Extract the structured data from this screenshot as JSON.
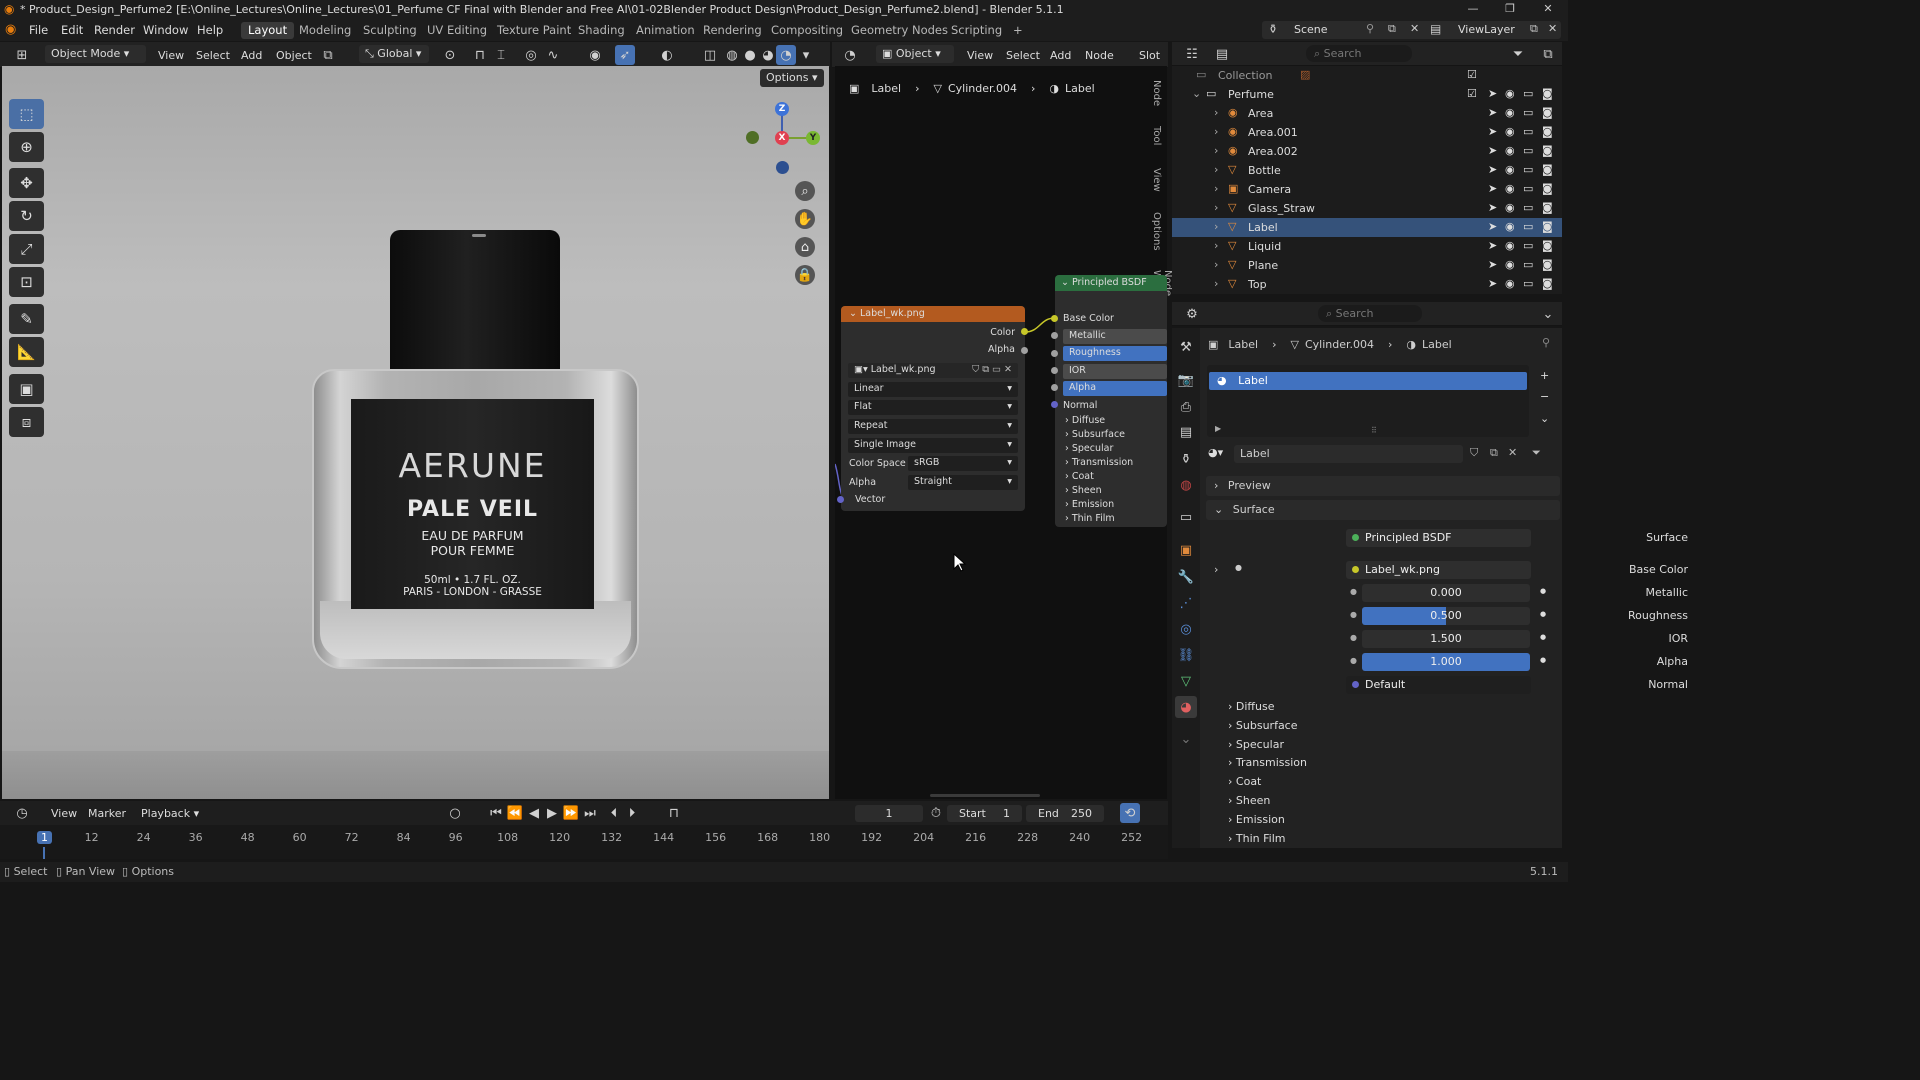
{
  "titlebar": {
    "title": "* Product_Design_Perfume2 [E:\\Online_Lectures\\Online_Lectures\\01_Perfume CF Final with Blender and Free AI\\01-02Blender Product Design\\Product_Design_Perfume2.blend] - Blender 5.1.1"
  },
  "menu": [
    "File",
    "Edit",
    "Render",
    "Window",
    "Help"
  ],
  "workspaces": [
    "Layout",
    "Modeling",
    "Sculpting",
    "UV Editing",
    "Texture Paint",
    "Shading",
    "Animation",
    "Rendering",
    "Compositing",
    "Geometry Nodes",
    "Scripting"
  ],
  "active_workspace": "Layout",
  "scene": {
    "label": "Scene",
    "view_layer": "ViewLayer"
  },
  "viewport": {
    "mode": "Object Mode",
    "menus": [
      "View",
      "Select",
      "Add",
      "Object"
    ],
    "transform": "Global",
    "options": "Options",
    "axes": {
      "z": "Z",
      "x": "X",
      "y": "Y"
    },
    "label_text": {
      "brand": "AERUNE",
      "name": "PALE VEIL",
      "line1": "EAU DE PARFUM",
      "line2": "POUR FEMME",
      "size": "50ml • 1.7 FL. OZ.",
      "cities": "PARIS - LONDON - GRASSE"
    }
  },
  "node_editor": {
    "type": "Object",
    "menus": [
      "View",
      "Select",
      "Add",
      "Node"
    ],
    "slot": "Slot",
    "breadcrumb": [
      "Label",
      "Cylinder.004",
      "Label"
    ],
    "side_tabs": [
      "Node",
      "Tool",
      "View",
      "Options",
      "Node Wrangler"
    ],
    "image_node": {
      "title": "Label_wk.png",
      "outputs": [
        "Color",
        "Alpha"
      ],
      "image": "Label_wk.png",
      "interpolation": "Linear",
      "projection": "Flat",
      "extension": "Repeat",
      "source": "Single Image",
      "color_space_label": "Color Space",
      "color_space": "sRGB",
      "alpha_label": "Alpha",
      "alpha": "Straight",
      "vector": "Vector"
    },
    "bsdf_node": {
      "title": "Principled BSDF",
      "inputs": [
        "Base Color",
        "Metallic",
        "Roughness",
        "IOR",
        "Alpha",
        "Normal"
      ],
      "panels": [
        "Diffuse",
        "Subsurface",
        "Specular",
        "Transmission",
        "Coat",
        "Sheen",
        "Emission",
        "Thin Film"
      ]
    }
  },
  "outliner": {
    "search_placeholder": "Search",
    "collection": "Collection",
    "perfume": "Perfume",
    "items": [
      "Area",
      "Area.001",
      "Area.002",
      "Bottle",
      "Camera",
      "Glass_Straw",
      "Label",
      "Liquid",
      "Plane",
      "Top"
    ],
    "selected": "Label"
  },
  "properties": {
    "search_placeholder": "Search",
    "breadcrumb": [
      "Label",
      "Cylinder.004",
      "Label"
    ],
    "material_slot": "Label",
    "material_name": "Label",
    "preview": "Preview",
    "surface_section": "Surface",
    "fields": [
      {
        "label": "Surface",
        "value": "Principled BSDF"
      },
      {
        "label": "Base Color",
        "value": "Label_wk.png"
      },
      {
        "label": "Metallic",
        "value": "0.000"
      },
      {
        "label": "Roughness",
        "value": "0.500"
      },
      {
        "label": "IOR",
        "value": "1.500"
      },
      {
        "label": "Alpha",
        "value": "1.000"
      },
      {
        "label": "Normal",
        "value": "Default"
      }
    ],
    "subsections": [
      "Diffuse",
      "Subsurface",
      "Specular",
      "Transmission",
      "Coat",
      "Sheen",
      "Emission",
      "Thin Film"
    ]
  },
  "timeline": {
    "menus": [
      "View",
      "Marker",
      "Playback"
    ],
    "current_frame": "1",
    "start_label": "Start",
    "start": "1",
    "end_label": "End",
    "end": "250",
    "ticks": [
      "1",
      "12",
      "24",
      "36",
      "48",
      "60",
      "72",
      "84",
      "96",
      "108",
      "120",
      "132",
      "144",
      "156",
      "168",
      "180",
      "192",
      "204",
      "216",
      "228",
      "240",
      "252"
    ]
  },
  "statusbar": {
    "items": [
      "Select",
      "Pan View",
      "Options"
    ],
    "version": "5.1.1"
  },
  "colors": {
    "accent": "#4772b3",
    "selected": "#35527a",
    "header_orange": "#b35a1f",
    "header_green": "#2b6e3f",
    "socket_yellow": "#c7c729",
    "socket_grey": "#a1a1a1",
    "socket_blue": "#6363c7"
  }
}
